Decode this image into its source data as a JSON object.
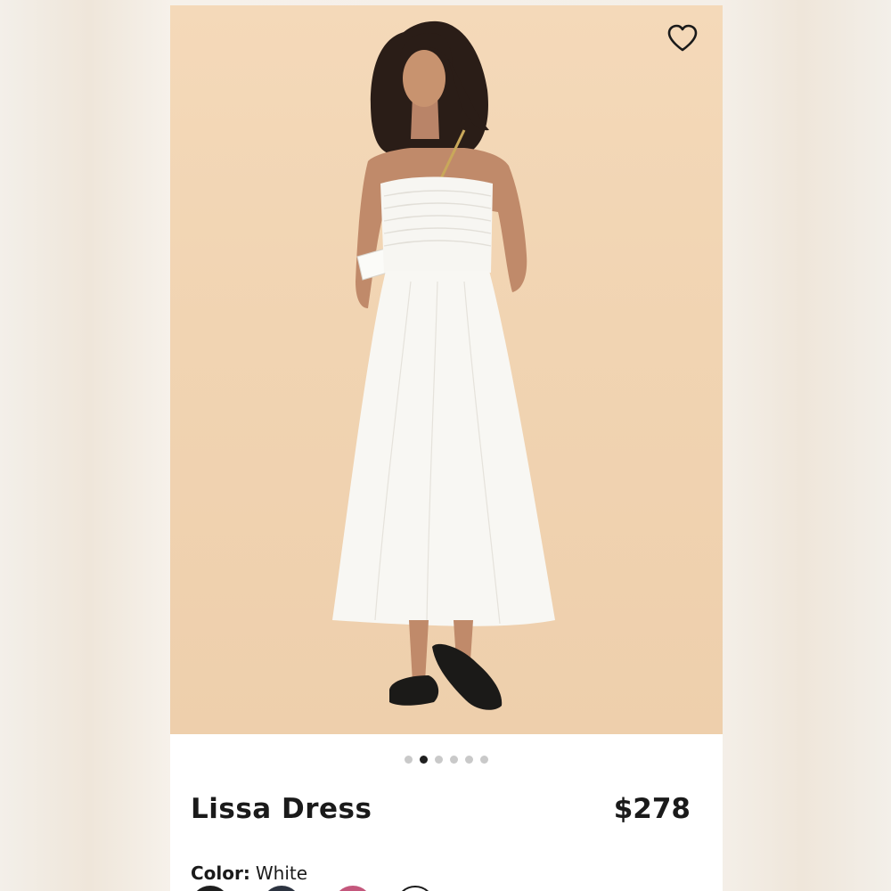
{
  "product": {
    "name": "Lissa Dress",
    "price": "$278",
    "color_label": "Color:",
    "color_value": "White"
  },
  "gallery": {
    "image_count": 6,
    "active_index": 1,
    "background_color": "#f1d4b2"
  },
  "icons": {
    "favorite": "heart-outline-icon"
  },
  "swatches": [
    {
      "name": "black",
      "color": "#1e1e1e",
      "selected": false
    },
    {
      "name": "navy",
      "color": "#2c3340",
      "selected": false
    },
    {
      "name": "pink",
      "color": "#c4577c",
      "selected": false
    },
    {
      "name": "white",
      "color": "#ffffff",
      "selected": true
    }
  ],
  "colors": {
    "text": "#1a1a1a",
    "dot_active": "#1f1f1f",
    "dot_inactive": "#c9c9c9"
  }
}
